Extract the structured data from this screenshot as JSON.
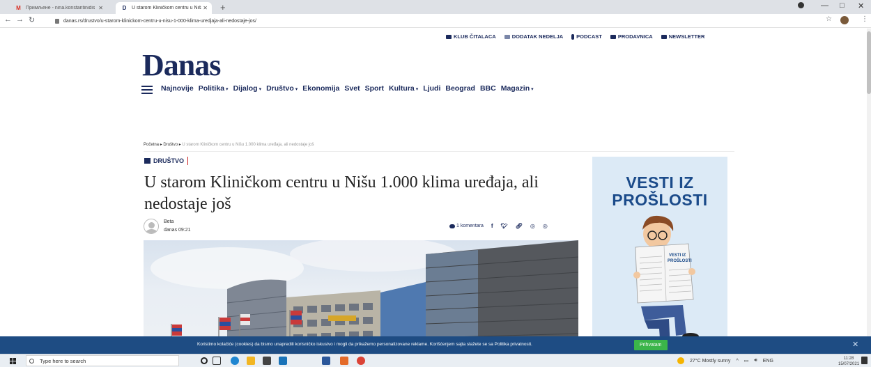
{
  "browser": {
    "tabs": [
      {
        "favicon": "M",
        "favicon_color": "#d93025",
        "title": "Примљене - nina.konstantinidis",
        "active": false
      },
      {
        "favicon": "D",
        "favicon_color": "#1b2a5c",
        "title": "U starom Kliničkom centru u Niš",
        "active": true
      }
    ],
    "new_tab_label": "+",
    "url": "danas.rs/drustvo/u-starom-klinickom-centru-u-nisu-1-000-klima-uredjaja-ali-nedostaje-jos/",
    "window_controls": [
      "—",
      "□",
      "✕"
    ]
  },
  "site": {
    "logo": "Danas",
    "top_links": [
      {
        "label": "KLUB ČITALACA",
        "icon": "book-icon"
      },
      {
        "label": "DODATAK NEDELJA",
        "icon": "newspaper-icon"
      },
      {
        "label": "PODCAST",
        "icon": "microphone-icon"
      },
      {
        "label": "PRODAVNICA",
        "icon": "cart-icon"
      },
      {
        "label": "NEWSLETTER",
        "icon": "envelope-icon"
      }
    ],
    "nav": [
      {
        "label": "Najnovije",
        "dropdown": false
      },
      {
        "label": "Politika",
        "dropdown": true
      },
      {
        "label": "Dijalog",
        "dropdown": true
      },
      {
        "label": "Društvo",
        "dropdown": true
      },
      {
        "label": "Ekonomija",
        "dropdown": false
      },
      {
        "label": "Svet",
        "dropdown": false
      },
      {
        "label": "Sport",
        "dropdown": false
      },
      {
        "label": "Kultura",
        "dropdown": true
      },
      {
        "label": "Ljudi",
        "dropdown": false
      },
      {
        "label": "Beograd",
        "dropdown": false
      },
      {
        "label": "BBC",
        "dropdown": false
      },
      {
        "label": "Magazin",
        "dropdown": true
      }
    ],
    "brand_color": "#1b2a5c"
  },
  "article": {
    "breadcrumb": {
      "home": "Početna",
      "section": "Društvo",
      "current": "U starom Kliničkom centru u Nišu 1.000 klima uređaja, ali nedostaje još"
    },
    "section_tag": "DRUŠTVO",
    "headline": "U starom Kliničkom centru u Nišu 1.000 klima uređaja, ali nedostaje još",
    "author": "Beta",
    "date": "danas 09:21",
    "comments": "1 komentara",
    "share_icons": [
      "facebook-icon",
      "twitter-icon",
      "link-icon",
      "whatsapp-icon",
      "viber-icon"
    ]
  },
  "ad": {
    "title_line1": "VESTI IZ",
    "title_line2": "PROŠLOSTI",
    "paper_line1": "VESTI IZ",
    "paper_line2": "PROŠLOSTI"
  },
  "cookie_banner": {
    "text": "Koristimo kolačiće (cookies) da bismo unapredili korisničko iskustvo i mogli da prikažemo personalizovane reklame. Korišćenjem sajta slažete se sa Politika privatnosti.",
    "accept_label": "Prihvatam",
    "close_label": "✕"
  },
  "taskbar": {
    "search_placeholder": "Type here to search",
    "weather": "27°C  Mostly sunny",
    "language": "ENG",
    "time": "11:28",
    "date": "15/07/2021"
  }
}
